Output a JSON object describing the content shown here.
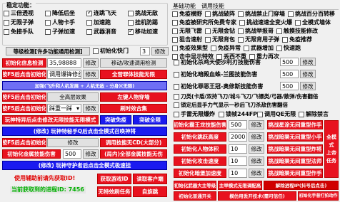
{
  "left": {
    "group_title": "稳定功能：",
    "checks": [
      {
        "label": "三倍透视",
        "checked": false
      },
      {
        "label": "降低后坐",
        "checked": false
      },
      {
        "label": "连跳飞天",
        "checked": true
      },
      {
        "label": "挑战无敌",
        "checked": false
      },
      {
        "label": "无限子弹",
        "checked": false
      },
      {
        "label": "人物卡手",
        "checked": false
      },
      {
        "label": "加速跑",
        "checked": false
      },
      {
        "label": "挂机防踢",
        "checked": false
      },
      {
        "label": "免接手队",
        "checked": false
      },
      {
        "label": "子弹加速",
        "checked": false
      },
      {
        "label": "武器消音",
        "checked": false
      },
      {
        "label": "移动加速",
        "checked": true
      }
    ],
    "level_btn": "等级检测[许多功能通用检测]",
    "init_speed_label": "初始化快门",
    "init_speed_value": "3",
    "edit": "修改",
    "r1_btn": "初始化信息检测",
    "r1_value": "35,98888",
    "r1_btn2": "修改",
    "r1_btn3": "移动/攻速调用检测",
    "r2_btn": "按F5后点击初始化",
    "r2_select": "调用爆锋修丝",
    "r2_btn2": "修改",
    "r2_btn3": "全营罪体技能无限",
    "r3_text": "加强(飞升和人机发展 + 人机无敌 - 分身)(无限)",
    "r4_btn": "按F5后点击初始化",
    "r4_btn2": "全高层效果",
    "r4_btn3": "左键人物穿墙",
    "r5_btn": "按F5后点击初始化",
    "r5_select": "踩重一踩",
    "r5_btn2": "修改",
    "r5_btn3": "刷时效合集",
    "r6_btn": "玩神特异后点击修改无限技能无限模式",
    "r6_btn2": "突破免疫",
    "r6_btn3": "突破全限",
    "r7_btn": "(修改) 玩神特秘手Q后点击全模式召唤神将",
    "r8_btn": "按F5后点击初始化",
    "r8_btn2": "修改",
    "r8_btn3": "调用技能无CD(大部分)",
    "r9_btn": "初始化金属技能伤害",
    "r9_value": "500",
    "r9_btn2": "修改",
    "r9_btn3": "(局内)全部金属技能无伤",
    "r10_btn": "(修改) 玩神守护者后点击全模式极速挂",
    "status1": "使用辅助前请先获取ID!",
    "status2": "当前获取到的进程ID: 7456",
    "b_btn1": "获取游戏ID",
    "b_btn2": "读取客户端",
    "b_btn3": "无特效刷任务",
    "b_btn4": "自旋跳",
    "b_btn5": "自旋跳"
  },
  "right": {
    "tabs": [
      "基础功能",
      "调用技能"
    ],
    "checks": [
      {
        "label": "免疫横野",
        "checked": false
      },
      {
        "label": "挑战破阵",
        "checked": false
      },
      {
        "label": "挑战禁止门穿墙",
        "checked": false
      },
      {
        "label": "挑战百分百转移",
        "checked": false
      },
      {
        "label": "免疫被研究所免费专家",
        "checked": false
      },
      {
        "label": "挑战速速全变火爆",
        "checked": false
      },
      {
        "label": "全模式墙体",
        "checked": false
      },
      {
        "label": "无限飞雷",
        "checked": false
      },
      {
        "label": "无限金钻",
        "checked": false
      },
      {
        "label": "挑战举报哥",
        "checked": false
      },
      {
        "label": "触摸技能修改",
        "checked": false
      },
      {
        "label": "狙击速射",
        "checked": false
      },
      {
        "label": "无限背包",
        "checked": false
      },
      {
        "label": "无限背用子弹",
        "checked": false
      },
      {
        "label": "免疫推荐",
        "checked": false
      },
      {
        "label": "免疫效果型",
        "checked": false
      },
      {
        "label": "免疫异常",
        "checked": false
      },
      {
        "label": "武器增加",
        "checked": false
      },
      {
        "label": "快速跑",
        "checked": false
      },
      {
        "label": "击中显示特效",
        "checked": false
      },
      {
        "label": "丢西不重",
        "checked": false
      },
      {
        "label": "重力再次",
        "checked": false
      }
    ],
    "row_a_label": "初始化杀鸡天使沙利刃技能伤害",
    "row_a_value": "500",
    "row_b_label": "初始化暗殿血蛛-兰图技能伤害",
    "row_b_value": "500",
    "row_c_label": "初始化罪恶王冠-奥修斯技能伤害",
    "row_c_value": "500",
    "row_d": "刀类(卡盾/双持飞刀/城斗飞刀/飞镖类/弓器/散弹/伤害翻倍",
    "row_e": "锁定后显手力气显示一秒后飞刀杀敌伤害翻倍",
    "row_f_1": "手雷无限爆炸",
    "row_f_2": "锁帧244FPS",
    "row_f_3": "调用QE无限",
    "row_f_4": "解除禁言",
    "g_btn1": "初始化霸王龙技能伤害",
    "g_value1": "500",
    "g_edit": "修改",
    "g_btn1b": "挑战星涂无间重型作手",
    "g_btn2": "初始化跳跃高度",
    "g_value2": "2000",
    "g_btn2b": "挑战暗渠无间重型小手",
    "g_btn3": "初始化人物体积",
    "g_value3": "10",
    "g_btn3b": "挑战暗渠无间重型炸将",
    "g_btn4": "初始化攻击速度",
    "g_value4": "10",
    "g_btn4b": "挑战暗渠无间重型法师",
    "g_btn5": "初始化暗堡加速度",
    "g_value5": "10",
    "g_btn5b": "挑战暗渠无间重型作手",
    "side_btn": "全模式\n上帝\n任务",
    "h_btn1": "初始化武器大主等级",
    "h_btn2": "主举模式无限调配高",
    "h_btn3": "解除进程IP(抖号后点击)",
    "h_btn4": "初始化普通开关",
    "h_btn5": "初始化普速",
    "i_btn1": "模仿用丢开技术(需可信任)",
    "i_btn2": "初始化手普打拍动作"
  }
}
